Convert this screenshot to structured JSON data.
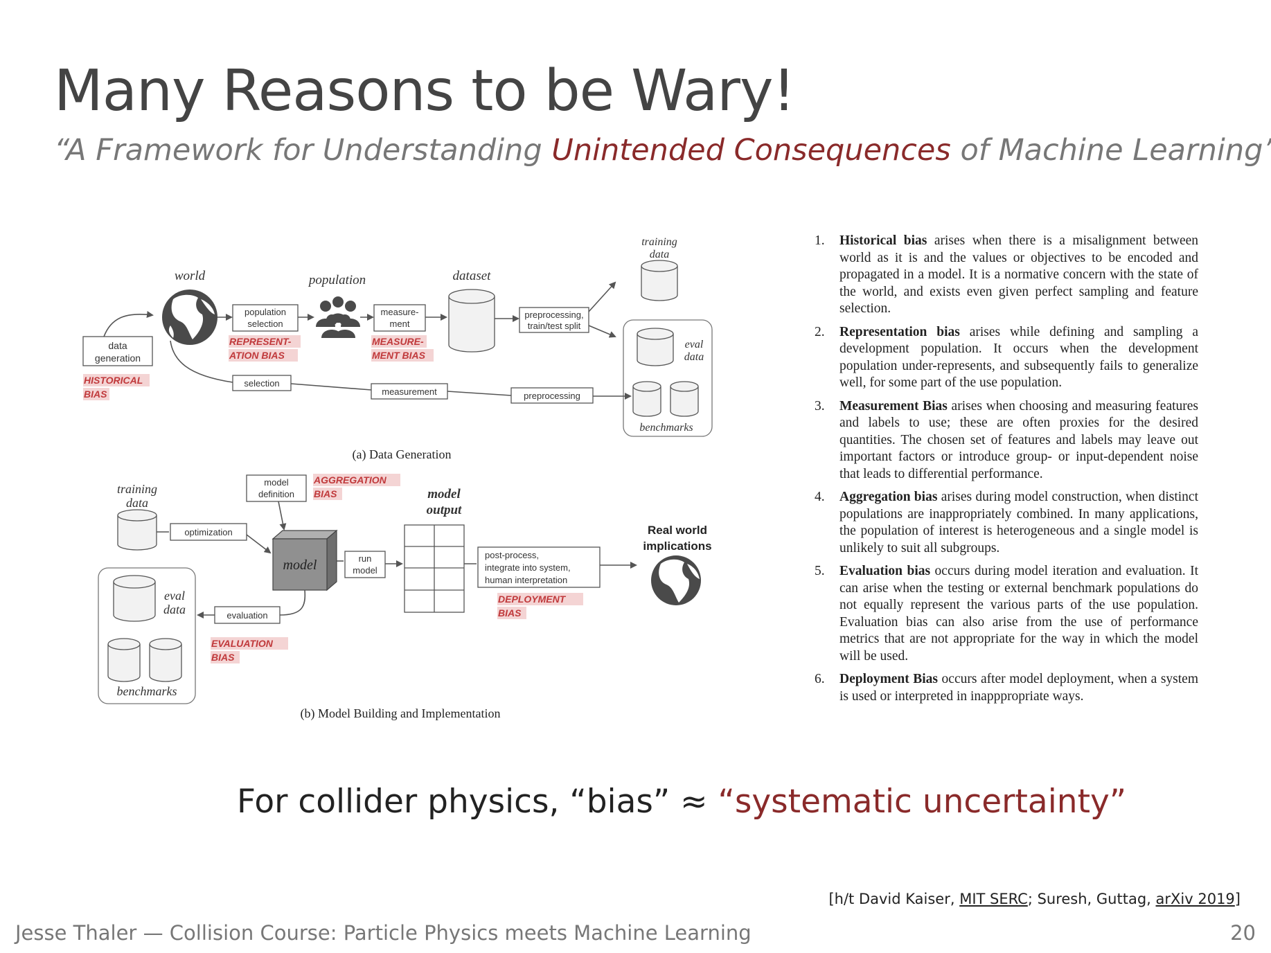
{
  "slide": {
    "title": "Many Reasons to be Wary!",
    "subtitle": {
      "prefix": "“A Framework for Understanding ",
      "highlight": "Unintended Consequences",
      "suffix": " of Machine Learning”"
    },
    "takeaway": {
      "prefix": "For collider physics, “bias” ≈ ",
      "highlight": "“systematic uncertainty”"
    },
    "citation": {
      "part1": "[h/t David Kaiser, ",
      "link1": "MIT SERC",
      "part2": "; Suresh, Guttag, ",
      "link2": "arXiv 2019",
      "part3": "]"
    },
    "footer": "Jesse Thaler — Collision Course:  Particle Physics meets Machine Learning",
    "page_number": "20"
  },
  "colors": {
    "accent": "#8a2a2a",
    "bias_label": "#c0393b",
    "bias_bg": "#f4d4d4"
  },
  "diagram_a": {
    "caption": "(a) Data Generation",
    "world": "world",
    "population": "population",
    "dataset": "dataset",
    "training_data_1": "training",
    "training_data_2": "data",
    "eval_data_1": "eval",
    "eval_data_2": "data",
    "benchmarks": "benchmarks",
    "data_generation_1": "data",
    "data_generation_2": "generation",
    "population_selection_1": "population",
    "population_selection_2": "selection",
    "measurement_box_1": "measure-",
    "measurement_box_2": "ment",
    "preprocessing_split_1": "preprocessing,",
    "preprocessing_split_2": "train/test split",
    "selection": "selection",
    "measurement": "measurement",
    "preprocessing": "preprocessing",
    "historical_bias_1": "HISTORICAL",
    "historical_bias_2": "BIAS",
    "representation_bias_1": "REPRESENT-",
    "representation_bias_2": "ATION BIAS",
    "measurement_bias_1": "MEASURE-",
    "measurement_bias_2": "MENT BIAS"
  },
  "diagram_b": {
    "caption": "(b) Model Building and Implementation",
    "training_data_1": "training",
    "training_data_2": "data",
    "eval_data_1": "eval",
    "eval_data_2": "data",
    "benchmarks": "benchmarks",
    "model_definition_1": "model",
    "model_definition_2": "definition",
    "aggregation_bias_1": "AGGREGATION",
    "aggregation_bias_2": "BIAS",
    "optimization": "optimization",
    "model": "model",
    "run_model_1": "run",
    "run_model_2": "model",
    "model_output_1": "model",
    "model_output_2": "output",
    "post_process_1": "post-process,",
    "post_process_2": "integrate into system,",
    "post_process_3": "human interpretation",
    "deployment_bias_1": "DEPLOYMENT",
    "deployment_bias_2": "BIAS",
    "evaluation": "evaluation",
    "evaluation_bias_1": "EVALUATION",
    "evaluation_bias_2": "BIAS",
    "real_world_1": "Real world",
    "real_world_2": "implications"
  },
  "bias_list": [
    {
      "num": "1.",
      "term": "Historical bias",
      "text": " arises when there is a misalignment between world as it is and the values or objectives to be encoded and propagated in a model. It is a normative concern with the state of the world, and exists even given perfect sampling and feature selection."
    },
    {
      "num": "2.",
      "term": "Representation bias",
      "text": " arises while defining and sampling a development population. It occurs when the development population under-represents, and subsequently fails to generalize well, for some part of the use population."
    },
    {
      "num": "3.",
      "term": "Measurement Bias",
      "text": " arises when choosing and measuring features and labels to use; these are often proxies for the desired quantities. The chosen set of features and labels may leave out important factors or introduce group- or input-dependent noise that leads to differential performance."
    },
    {
      "num": "4.",
      "term": "Aggregation bias",
      "text": " arises during model construction, when distinct populations are inappropriately combined. In many applications, the population of interest is heterogeneous and a single model is unlikely to suit all subgroups."
    },
    {
      "num": "5.",
      "term": "Evaluation bias",
      "text": " occurs during model iteration and evaluation. It can arise when the testing or external benchmark populations do not equally represent the various parts of the use population. Evaluation bias can also arise from the use of performance metrics that are not appropriate for the way in which the model will be used."
    },
    {
      "num": "6.",
      "term": "Deployment Bias",
      "text": " occurs after model deployment, when a system is used or interpreted in inapppropriate ways."
    }
  ]
}
